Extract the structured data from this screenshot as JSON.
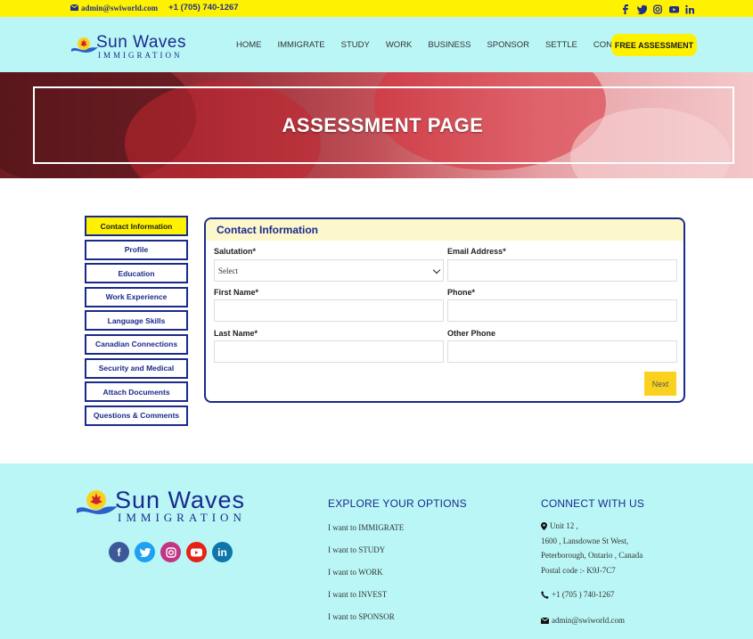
{
  "topbar": {
    "email": "admin@swiworld.com",
    "phone": "+1 (705) 740-1267",
    "social_icons": [
      "facebook-icon",
      "twitter-icon",
      "instagram-icon",
      "youtube-icon",
      "linkedin-icon"
    ]
  },
  "header": {
    "logo_brand": "Sun Waves",
    "logo_sub": "IMMIGRATION",
    "nav": [
      "HOME",
      "IMMIGRATE",
      "STUDY",
      "WORK",
      "BUSINESS",
      "SPONSOR",
      "SETTLE",
      "CONTACT"
    ],
    "cta": "FREE ASSESSMENT"
  },
  "hero": {
    "title": "ASSESSMENT PAGE"
  },
  "steps": [
    "Contact Information",
    "Profile",
    "Education",
    "Work Experience",
    "Language Skills",
    "Canadian Connections",
    "Security and Medical",
    "Attach Documents",
    "Questions & Comments"
  ],
  "form": {
    "title": "Contact Information",
    "salutation_label": "Salutation*",
    "salutation_value": "Select",
    "email_label": "Email Address*",
    "first_name_label": "First Name*",
    "phone_label": "Phone*",
    "last_name_label": "Last Name*",
    "other_phone_label": "Other Phone",
    "next_label": "Next"
  },
  "footer": {
    "logo_brand": "Sun Waves",
    "logo_sub": "IMMIGRATION",
    "explore_title": "EXPLORE YOUR OPTIONS",
    "explore_links": [
      "I want to IMMIGRATE",
      "I want to STUDY",
      "I want to WORK",
      "I want to INVEST",
      "I want to SPONSOR"
    ],
    "connect_title": "CONNECT WITH US",
    "address_lines": [
      "Unit 12 ,",
      "1600 , Lansdowne St West,",
      "Peterborough, Ontario , Canada",
      "Postal code :- K9J-7C7"
    ],
    "phone": "+1 (705 ) 740-1267",
    "email": "admin@swiworld.com"
  },
  "colors": {
    "topbar": "#fff200",
    "header_bg": "#baf6f6",
    "brand_blue": "#1a2a8c",
    "accent_yellow": "#fff200",
    "next_button": "#fbd11f"
  }
}
